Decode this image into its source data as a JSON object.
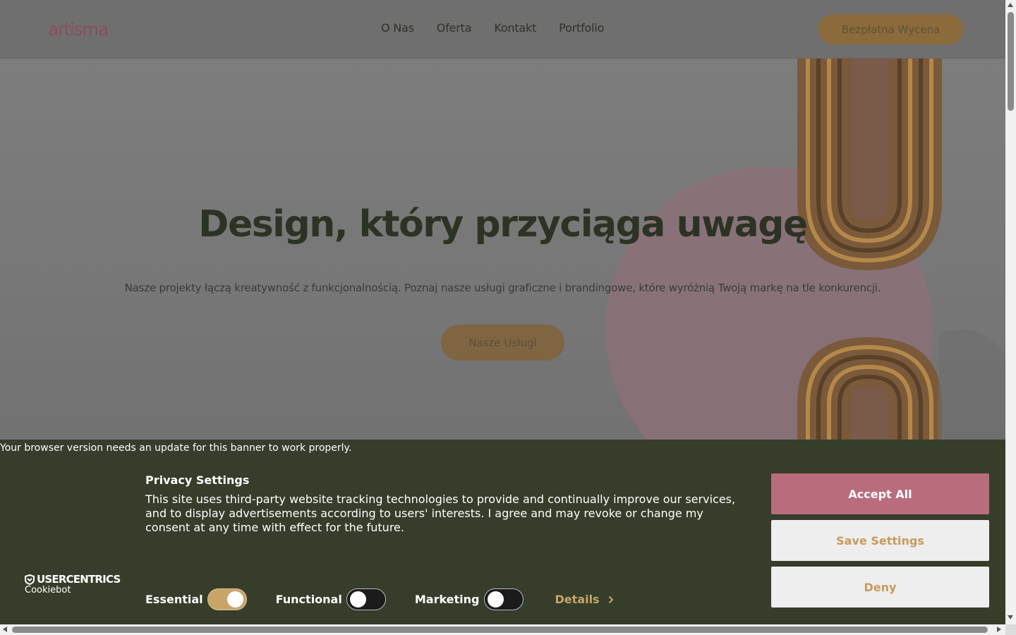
{
  "header": {
    "logo_text": "artisma",
    "nav": [
      {
        "label": "O Nas"
      },
      {
        "label": "Oferta"
      },
      {
        "label": "Kontakt"
      },
      {
        "label": "Portfolio"
      }
    ],
    "cta_label": "Bezpłatna Wycena"
  },
  "hero": {
    "title": "Design, który przyciąga uwagę",
    "text": "Nasze projekty łączą kreatywność z funkcjonalnością. Poznaj nasze usługi graficzne i brandingowe, które wyróżnią Twoją markę na tle konkurencji.",
    "cta_label": "Nasze Usługi"
  },
  "cookie_banner": {
    "warning": "Your browser version needs an update for this banner to work properly.",
    "brand_name": "USERCENTRICS",
    "brand_sub": "Cookiebot",
    "title": "Privacy Settings",
    "text": "This site uses third-party website tracking technologies to provide and continually improve our services, and to display advertisements according to users' interests. I agree and may revoke or change my consent at any time with effect for the future.",
    "toggles": [
      {
        "label": "Essential",
        "on": true
      },
      {
        "label": "Functional",
        "on": false
      },
      {
        "label": "Marketing",
        "on": false
      }
    ],
    "details_label": "Details",
    "accept_label": "Accept All",
    "save_label": "Save Settings",
    "deny_label": "Deny"
  },
  "colors": {
    "banner_bg": "#363d2a",
    "accent_pink": "#b96d7c",
    "accent_gold": "#c9a469"
  },
  "icons": {
    "brand": "shield-icon",
    "details": "chevron-right-icon"
  }
}
